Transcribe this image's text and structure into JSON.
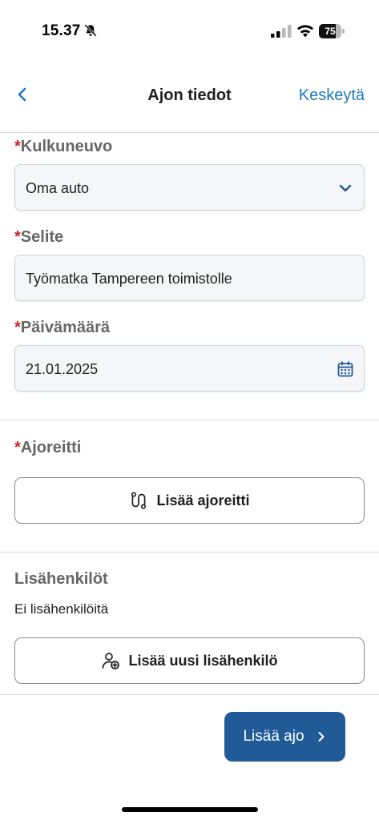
{
  "status_bar": {
    "time": "15.37",
    "battery_percent": 75,
    "battery_label": "75"
  },
  "header": {
    "title": "Ajon tiedot",
    "cancel_label": "Keskeytä",
    "accent_color": "#1e7bbf"
  },
  "form": {
    "required_marker": "*",
    "vehicle": {
      "label": "Kulkuneuvo",
      "value": "Oma auto"
    },
    "description": {
      "label": "Selite",
      "value": "Työmatka Tampereen toimistolle"
    },
    "date": {
      "label": "Päivämäärä",
      "value": "21.01.2025"
    },
    "route": {
      "label": "Ajoreitti",
      "button_label": "Lisää ajoreitti"
    },
    "extra_people": {
      "label": "Lisähenkilöt",
      "empty_text": "Ei lisähenkilöitä",
      "button_label": "Lisää uusi lisähenkilö"
    }
  },
  "footer": {
    "primary_label": "Lisää ajo",
    "primary_color": "#205a97"
  },
  "icons": [
    "bell-off-icon",
    "signal-icon",
    "wifi-icon",
    "battery-icon",
    "chevron-left-icon",
    "chevron-down-icon",
    "calendar-icon",
    "route-icon",
    "add-person-icon",
    "chevron-right-icon"
  ]
}
